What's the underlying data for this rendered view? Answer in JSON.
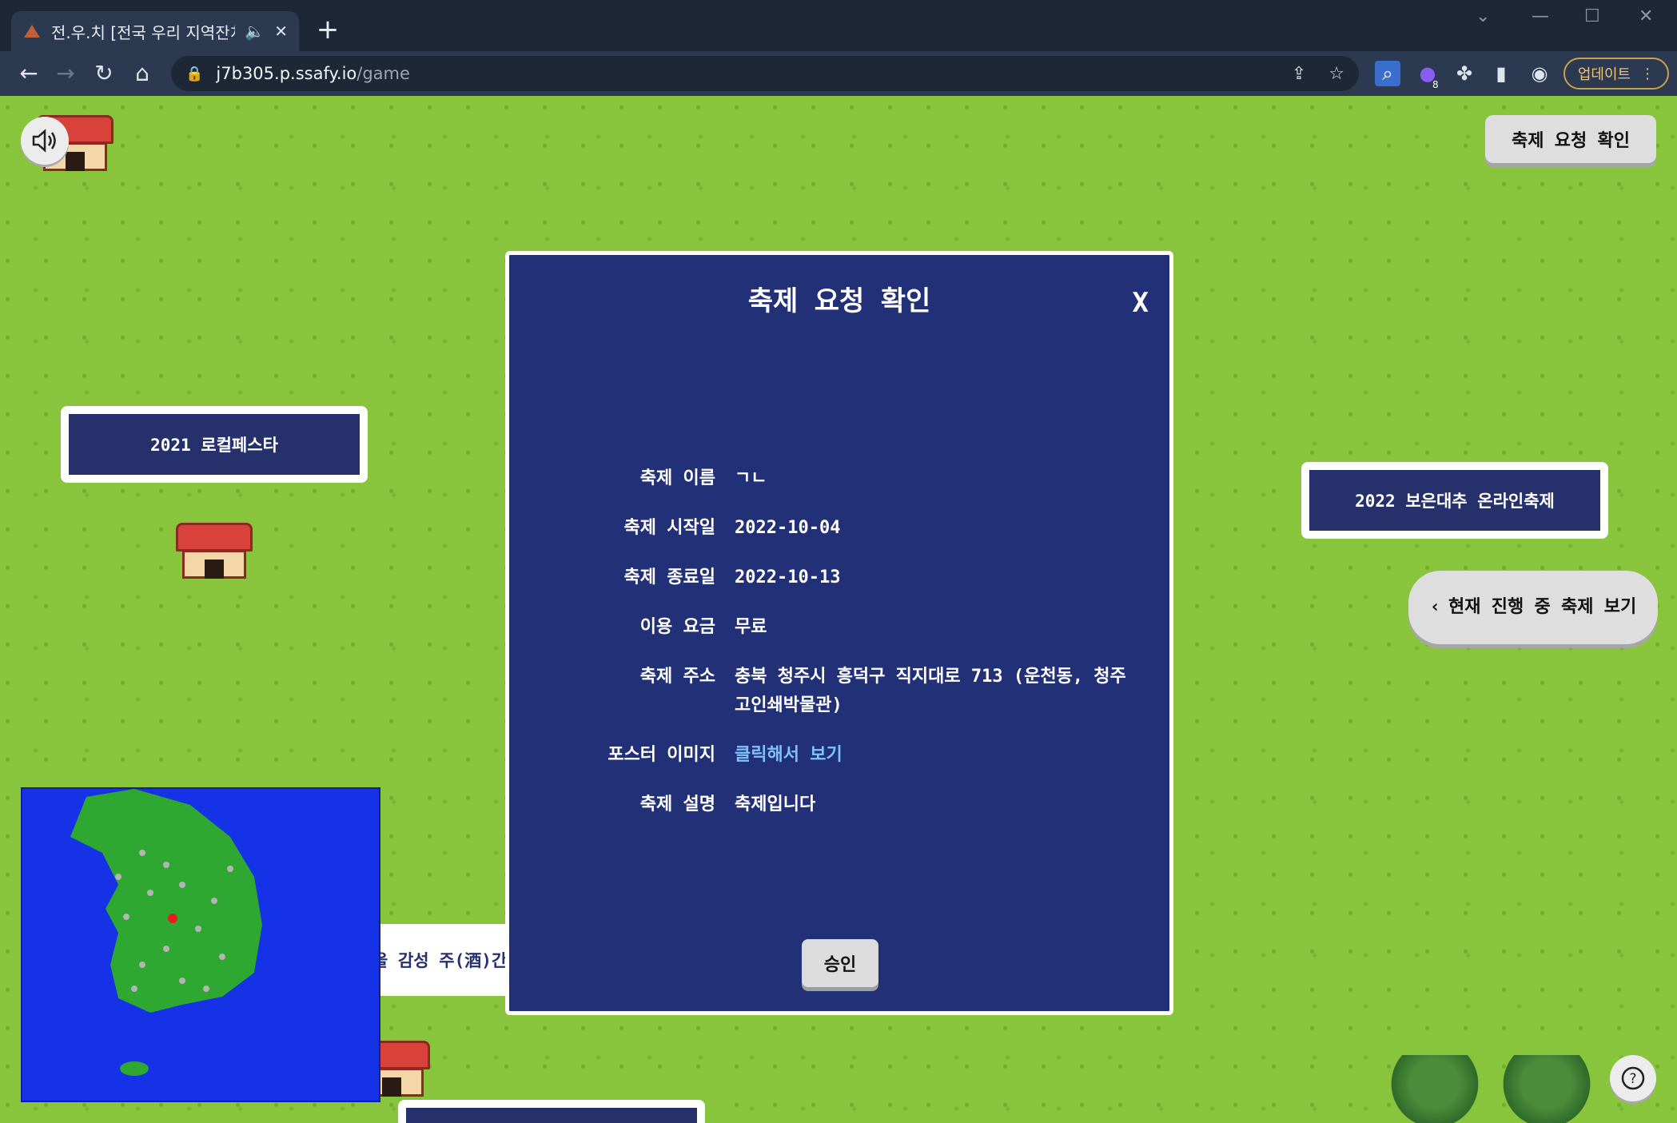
{
  "browser": {
    "tab_title": "전.우.치 [전국 우리 지역잔치",
    "new_tab": "+",
    "url_host": "j7b305.p.ssafy.io",
    "url_path": "/game",
    "update_label": "업데이트",
    "extension_badge": "8"
  },
  "game": {
    "top_right_button": "축제 요청 확인",
    "current_festivals_button": "현재 진행 중 축제 보기",
    "signs": [
      {
        "label": "2021 로컬페스타"
      },
      {
        "label": "2022 보은대추 온라인축제"
      },
      {
        "label": "을 감성 주(酒)간"
      }
    ]
  },
  "modal": {
    "title": "축제 요청 확인",
    "close": "X",
    "fields": [
      {
        "label": "축제 이름",
        "value": "ㄱㄴ"
      },
      {
        "label": "축제 시작일",
        "value": "2022-10-04"
      },
      {
        "label": "축제 종료일",
        "value": "2022-10-13"
      },
      {
        "label": "이용 요금",
        "value": "무료"
      },
      {
        "label": "축제 주소",
        "value": "충북 청주시 흥덕구 직지대로 713 (운천동, 청주고인쇄박물관)"
      },
      {
        "label": "포스터 이미지",
        "value": "클릭해서 보기"
      },
      {
        "label": "축제 설명",
        "value": "축제입니다"
      }
    ],
    "approve": "승인"
  },
  "colors": {
    "modal_bg": "#223078",
    "grass": "#88c43c",
    "link": "#7fc2ff"
  }
}
